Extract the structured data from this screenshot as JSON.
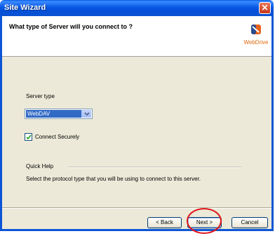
{
  "window": {
    "title": "Site Wizard",
    "close_glyph": "✕"
  },
  "header": {
    "question": "What type of Server will you connect to ?",
    "logo_text": "WebDrive"
  },
  "form": {
    "server_type_label": "Server type",
    "server_type_value": "WebDAV",
    "connect_securely_label": "Connect Securely",
    "connect_securely_checked": true
  },
  "help": {
    "heading": "Quick Help",
    "text": "Select the protocol type that you will be using to connect to this server."
  },
  "buttons": {
    "back": "< Back",
    "next": "Next >",
    "cancel": "Cancel"
  },
  "colors": {
    "titlebar": "#0859e4",
    "selection": "#316ac5",
    "highlight_ring": "#e0161a",
    "dialog_bg": "#ece9d8"
  }
}
